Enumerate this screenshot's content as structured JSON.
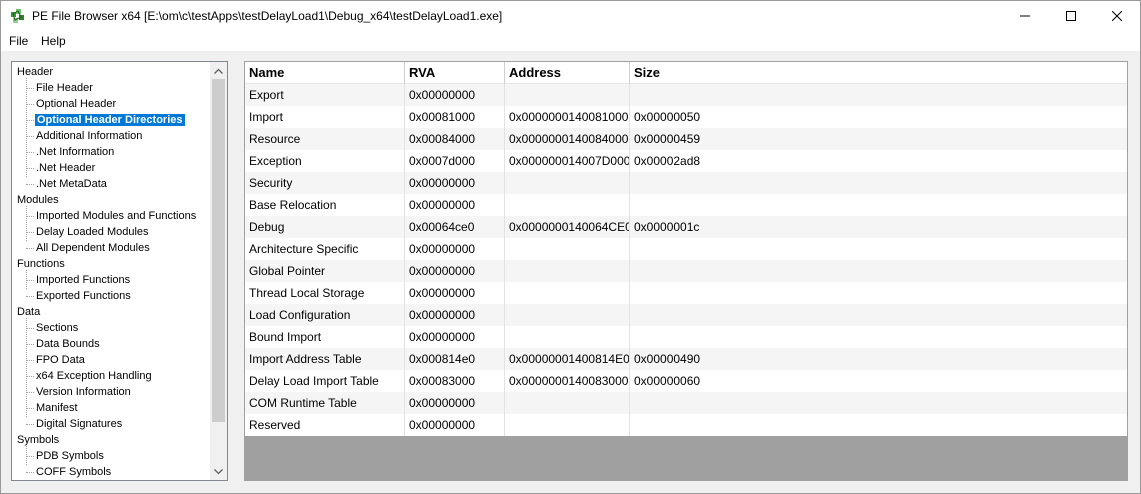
{
  "window": {
    "title": "PE File Browser x64 [E:\\om\\c\\testApps\\testDelayLoad1\\Debug_x64\\testDelayLoad1.exe]",
    "icon": "pe-browser-app-icon"
  },
  "menu": {
    "file": "File",
    "help": "Help"
  },
  "tree": {
    "groups": [
      {
        "label": "Header",
        "children": [
          "File Header",
          "Optional Header",
          "Optional Header Directories",
          "Additional Information",
          ".Net Information",
          ".Net Header",
          ".Net MetaData"
        ]
      },
      {
        "label": "Modules",
        "children": [
          "Imported Modules and Functions",
          "Delay Loaded Modules",
          "All Dependent Modules"
        ]
      },
      {
        "label": "Functions",
        "children": [
          "Imported Functions",
          "Exported Functions"
        ]
      },
      {
        "label": "Data",
        "children": [
          "Sections",
          "Data Bounds",
          "FPO Data",
          "x64 Exception Handling",
          "Version Information",
          "Manifest",
          "Digital Signatures"
        ]
      },
      {
        "label": "Symbols",
        "children": [
          "PDB Symbols",
          "COFF Symbols"
        ]
      }
    ],
    "selected": "Optional Header Directories"
  },
  "grid": {
    "columns": [
      "Name",
      "RVA",
      "Address",
      "Size"
    ],
    "rows": [
      {
        "name": "Export",
        "rva": "0x00000000",
        "address": "",
        "size": ""
      },
      {
        "name": "Import",
        "rva": "0x00081000",
        "address": "0x0000000140081000",
        "size": "0x00000050"
      },
      {
        "name": "Resource",
        "rva": "0x00084000",
        "address": "0x0000000140084000",
        "size": "0x00000459"
      },
      {
        "name": "Exception",
        "rva": "0x0007d000",
        "address": "0x000000014007D000",
        "size": "0x00002ad8"
      },
      {
        "name": "Security",
        "rva": "0x00000000",
        "address": "",
        "size": ""
      },
      {
        "name": "Base Relocation",
        "rva": "0x00000000",
        "address": "",
        "size": ""
      },
      {
        "name": "Debug",
        "rva": "0x00064ce0",
        "address": "0x0000000140064CE0",
        "size": "0x0000001c"
      },
      {
        "name": "Architecture Specific",
        "rva": "0x00000000",
        "address": "",
        "size": ""
      },
      {
        "name": "Global Pointer",
        "rva": "0x00000000",
        "address": "",
        "size": ""
      },
      {
        "name": "Thread Local Storage",
        "rva": "0x00000000",
        "address": "",
        "size": ""
      },
      {
        "name": "Load Configuration",
        "rva": "0x00000000",
        "address": "",
        "size": ""
      },
      {
        "name": "Bound Import",
        "rva": "0x00000000",
        "address": "",
        "size": ""
      },
      {
        "name": "Import Address Table",
        "rva": "0x000814e0",
        "address": "0x00000001400814E0",
        "size": "0x00000490"
      },
      {
        "name": "Delay Load Import Table",
        "rva": "0x00083000",
        "address": "0x0000000140083000",
        "size": "0x00000060"
      },
      {
        "name": "COM Runtime Table",
        "rva": "0x00000000",
        "address": "",
        "size": ""
      },
      {
        "name": "Reserved",
        "rva": "0x00000000",
        "address": "",
        "size": ""
      }
    ]
  },
  "colors": {
    "selection": "#0078d7",
    "grid_empty": "#a0a0a0"
  }
}
